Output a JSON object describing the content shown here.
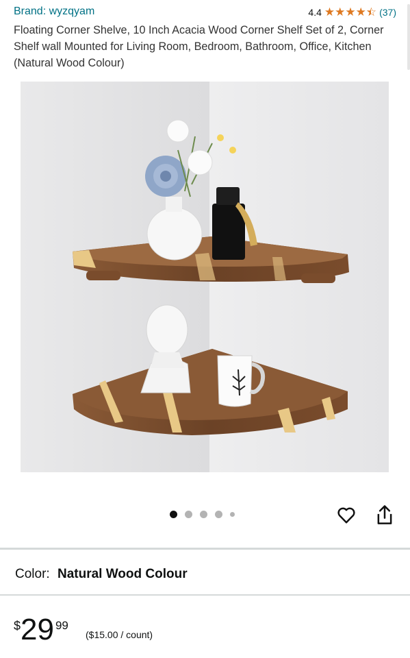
{
  "header": {
    "brand": "Brand: wyzqyam",
    "rating_value": "4.4",
    "rating_stars": 4.4,
    "rating_count": "(37)"
  },
  "product": {
    "title": "Floating Corner Shelve, 10 Inch Acacia Wood Corner Shelf Set of 2, Corner Shelf wall Mounted for Living Room, Bedroom, Bathroom, Office, Kitchen (Natural Wood Colour)"
  },
  "gallery": {
    "total_images": 5,
    "active_index": 0
  },
  "actions": {
    "wishlist_icon": "heart-icon",
    "share_icon": "share-icon"
  },
  "variation": {
    "label": "Color:",
    "value": "Natural Wood Colour"
  },
  "pricing": {
    "currency_symbol": "$",
    "whole": "29",
    "fraction": "99",
    "unit_price": "($15.00 / count)"
  },
  "colors": {
    "link": "#007185",
    "star": "#de7921",
    "text": "#0f1111"
  }
}
